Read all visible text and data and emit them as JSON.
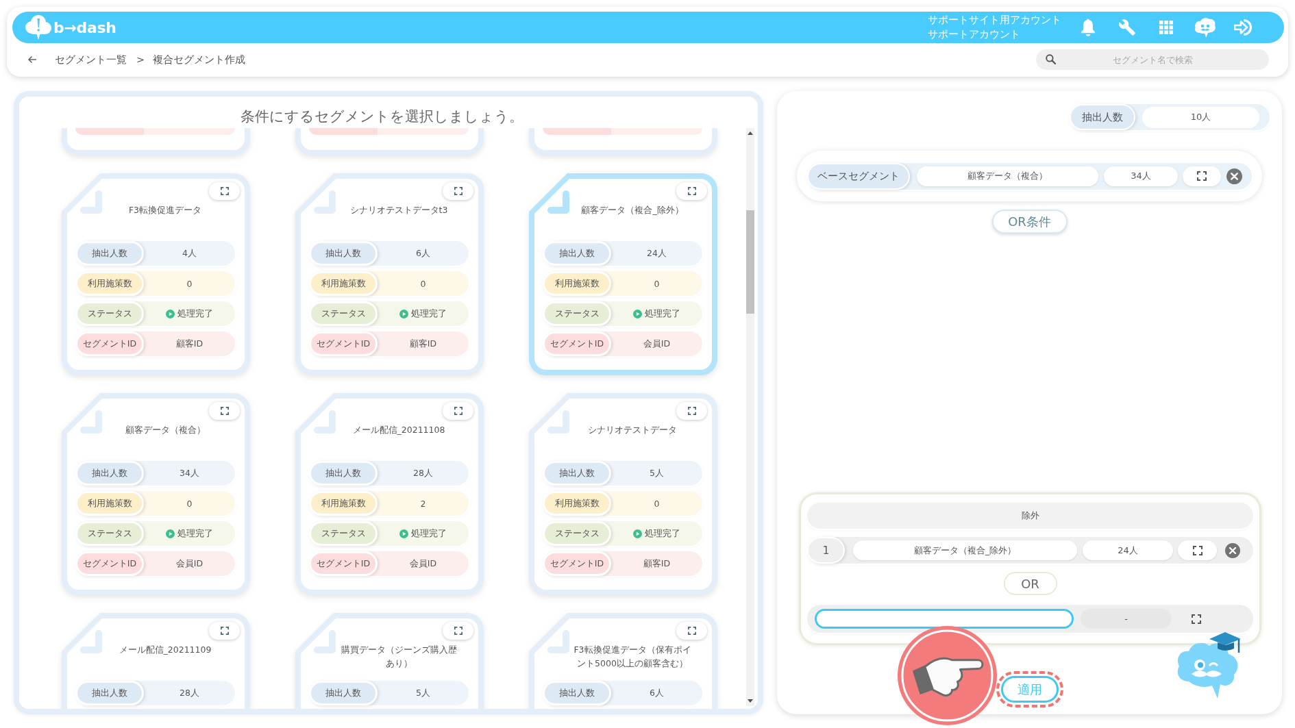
{
  "header": {
    "logo": "b→dash",
    "account": [
      "サポートサイト用アカウント",
      "サポートアカウント"
    ]
  },
  "breadcrumb": {
    "items": [
      "セグメント一覧",
      "複合セグメント作成"
    ],
    "separator": ">"
  },
  "search": {
    "placeholder": "セグメント名で検索"
  },
  "segment_picker": {
    "title": "条件にするセグメントを選択しましょう。",
    "cards": [
      {
        "kind": "cut",
        "selected": false
      },
      {
        "kind": "cut",
        "selected": false
      },
      {
        "kind": "cut",
        "selected": false
      },
      {
        "kind": "full",
        "title": "F3転換促進データ",
        "selected": false,
        "rows": [
          {
            "kind": "count",
            "label": "抽出人数",
            "value": "4人"
          },
          {
            "kind": "measures",
            "label": "利用施策数",
            "value": "0"
          },
          {
            "kind": "status",
            "label": "ステータス",
            "value": "処理完了"
          },
          {
            "kind": "id",
            "label": "セグメントID",
            "value": "顧客ID"
          }
        ]
      },
      {
        "kind": "full",
        "title": "シナリオテストデータt3",
        "selected": false,
        "rows": [
          {
            "kind": "count",
            "label": "抽出人数",
            "value": "6人"
          },
          {
            "kind": "measures",
            "label": "利用施策数",
            "value": "0"
          },
          {
            "kind": "status",
            "label": "ステータス",
            "value": "処理完了"
          },
          {
            "kind": "id",
            "label": "セグメントID",
            "value": "顧客ID"
          }
        ]
      },
      {
        "kind": "full",
        "title": "顧客データ（複合_除外）",
        "selected": true,
        "rows": [
          {
            "kind": "count",
            "label": "抽出人数",
            "value": "24人"
          },
          {
            "kind": "measures",
            "label": "利用施策数",
            "value": "0"
          },
          {
            "kind": "status",
            "label": "ステータス",
            "value": "処理完了"
          },
          {
            "kind": "id",
            "label": "セグメントID",
            "value": "会員ID"
          }
        ]
      },
      {
        "kind": "full",
        "title": "顧客データ（複合）",
        "selected": false,
        "rows": [
          {
            "kind": "count",
            "label": "抽出人数",
            "value": "34人"
          },
          {
            "kind": "measures",
            "label": "利用施策数",
            "value": "0"
          },
          {
            "kind": "status",
            "label": "ステータス",
            "value": "処理完了"
          },
          {
            "kind": "id",
            "label": "セグメントID",
            "value": "会員ID"
          }
        ]
      },
      {
        "kind": "full",
        "title": "メール配信_20211108",
        "selected": false,
        "rows": [
          {
            "kind": "count",
            "label": "抽出人数",
            "value": "28人"
          },
          {
            "kind": "measures",
            "label": "利用施策数",
            "value": "2"
          },
          {
            "kind": "status",
            "label": "ステータス",
            "value": "処理完了"
          },
          {
            "kind": "id",
            "label": "セグメントID",
            "value": "会員ID"
          }
        ]
      },
      {
        "kind": "full",
        "title": "シナリオテストデータ",
        "selected": false,
        "rows": [
          {
            "kind": "count",
            "label": "抽出人数",
            "value": "5人"
          },
          {
            "kind": "measures",
            "label": "利用施策数",
            "value": "0"
          },
          {
            "kind": "status",
            "label": "ステータス",
            "value": "処理完了"
          },
          {
            "kind": "id",
            "label": "セグメントID",
            "value": "顧客ID"
          }
        ]
      },
      {
        "kind": "full",
        "title": "メール配信_20211109",
        "selected": false,
        "rows": [
          {
            "kind": "count",
            "label": "抽出人数",
            "value": "28人"
          }
        ]
      },
      {
        "kind": "full",
        "title": "購買データ（ジーンズ購入歴あり）",
        "selected": false,
        "rows": [
          {
            "kind": "count",
            "label": "抽出人数",
            "value": "5人"
          }
        ]
      },
      {
        "kind": "full",
        "title": "F3転換促進データ（保有ポイント5000以上の顧客含む）",
        "selected": false,
        "rows": [
          {
            "kind": "count",
            "label": "抽出人数",
            "value": "6人"
          }
        ]
      }
    ]
  },
  "composite": {
    "count": {
      "label": "抽出人数",
      "value": "10人"
    },
    "base": {
      "label": "ベースセグメント",
      "name": "顧客データ（複合）",
      "count": "34人"
    },
    "or_condition_button": "OR条件",
    "exclusion": {
      "title": "除外",
      "items": [
        {
          "index": "1",
          "name": "顧客データ（複合_除外）",
          "count": "24人"
        }
      ],
      "or_label": "OR",
      "new_item": {
        "focused": true,
        "count": "-"
      }
    },
    "apply_button": {
      "label": "適用",
      "highlighted": true
    }
  }
}
